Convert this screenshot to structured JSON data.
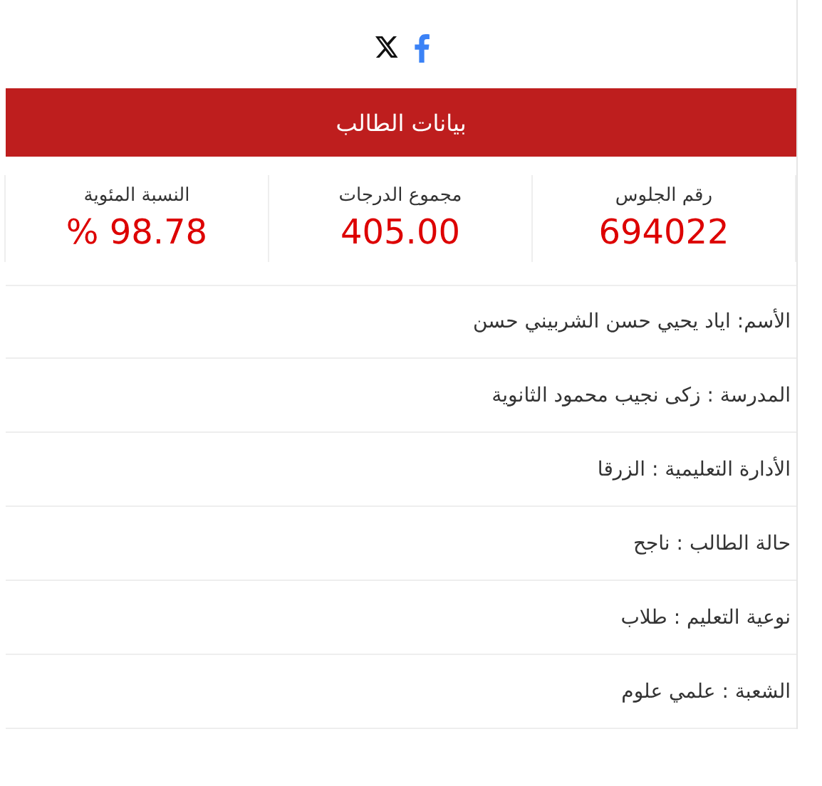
{
  "share": [
    {
      "kind": "x"
    },
    {
      "kind": "facebook"
    }
  ],
  "header": {
    "title": "بيانات الطالب"
  },
  "stats": [
    {
      "label": "رقم الجلوس",
      "value": "694022"
    },
    {
      "label": "مجموع الدرجات",
      "value": "405.00"
    },
    {
      "label": "النسبة المئوية",
      "value": "% 98.78"
    }
  ],
  "details": [
    "الأسم: اياد يحيي حسن الشربيني حسن",
    "المدرسة : زكى نجيب محمود الثانوية",
    "الأدارة التعليمية : الزرقا",
    "حالة الطالب : ناجح",
    "نوعية التعليم : طلاب",
    "الشعبة : علمي علوم"
  ]
}
